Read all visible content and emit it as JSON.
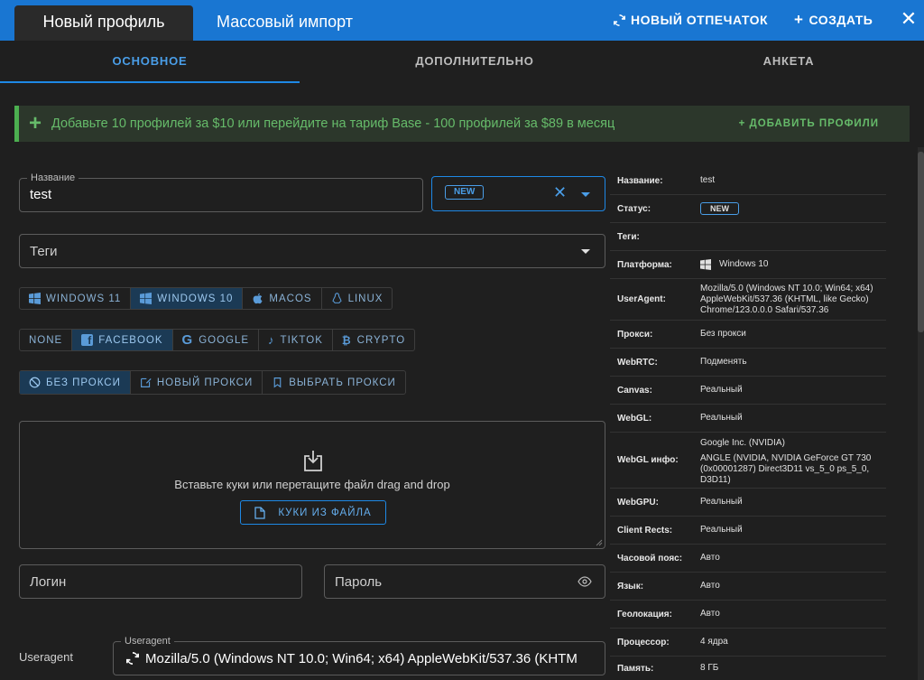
{
  "topbar": {
    "tab_new_profile": "Новый профиль",
    "tab_mass_import": "Массовый импорт",
    "new_fingerprint": "НОВЫЙ ОТПЕЧАТОК",
    "create": "СОЗДАТЬ",
    "colors": {
      "bar": "#1976d2",
      "active_tab": "#2a2a2a"
    }
  },
  "subtabs": [
    "ОСНОВНОЕ",
    "ДОПОЛНИТЕЛЬНО",
    "АНКЕТА"
  ],
  "promo": {
    "text": "Добавьте 10 профилей за $10 или перейдите на тариф Base - 100 профилей за $89 в месяц",
    "button": "+ ДОБАВИТЬ ПРОФИЛИ"
  },
  "form": {
    "name_label": "Название",
    "name_value": "test",
    "status_badge": "NEW",
    "tags_placeholder": "Теги",
    "os": [
      "WINDOWS 11",
      "WINDOWS 10",
      "MACOS",
      "LINUX"
    ],
    "os_selected": "WINDOWS 10",
    "templates": [
      "NONE",
      "FACEBOOK",
      "GOOGLE",
      "TIKTOK",
      "CRYPTO"
    ],
    "template_selected": "FACEBOOK",
    "proxy": [
      "БЕЗ ПРОКСИ",
      "НОВЫЙ ПРОКСИ",
      "ВЫБРАТЬ ПРОКСИ"
    ],
    "proxy_selected": "БЕЗ ПРОКСИ",
    "cookies_text": "Вставьте куки или перетащите файл drag and drop",
    "cookies_button": "КУКИ ИЗ ФАЙЛА",
    "login_placeholder": "Логин",
    "password_placeholder": "Пароль",
    "useragent_side_label": "Useragent",
    "useragent_label": "Useragent",
    "useragent_value": "Mozilla/5.0 (Windows NT 10.0; Win64; x64) AppleWebKit/537.36 (KHTM"
  },
  "summary": {
    "name_key": "Название:",
    "name_val": "test",
    "status_key": "Статус:",
    "status_val": "NEW",
    "tags_key": "Теги:",
    "platform_key": "Платформа:",
    "platform_val": "Windows 10",
    "ua_key": "UserAgent:",
    "ua_val": "Mozilla/5.0 (Windows NT 10.0; Win64; x64) AppleWebKit/537.36 (KHTML, like Gecko) Chrome/123.0.0.0 Safari/537.36",
    "proxy_key": "Прокси:",
    "proxy_val": "Без прокси",
    "webrtc_key": "WebRTC:",
    "webrtc_val": "Подменять",
    "canvas_key": "Canvas:",
    "canvas_val": "Реальный",
    "webgl_key": "WebGL:",
    "webgl_val": "Реальный",
    "webglinfo_key": "WebGL инфо:",
    "webglinfo_vendor": "Google Inc. (NVIDIA)",
    "webglinfo_renderer": "ANGLE (NVIDIA, NVIDIA GeForce GT 730 (0x00001287) Direct3D11 vs_5_0 ps_5_0, D3D11)",
    "webgpu_key": "WebGPU:",
    "webgpu_val": "Реальный",
    "rects_key": "Client Rects:",
    "rects_val": "Реальный",
    "tz_key": "Часовой пояс:",
    "tz_val": "Авто",
    "lang_key": "Язык:",
    "lang_val": "Авто",
    "geo_key": "Геолокация:",
    "geo_val": "Авто",
    "cpu_key": "Процессор:",
    "cpu_val": "4 ядра",
    "mem_key": "Память:",
    "mem_val": "8 ГБ"
  }
}
